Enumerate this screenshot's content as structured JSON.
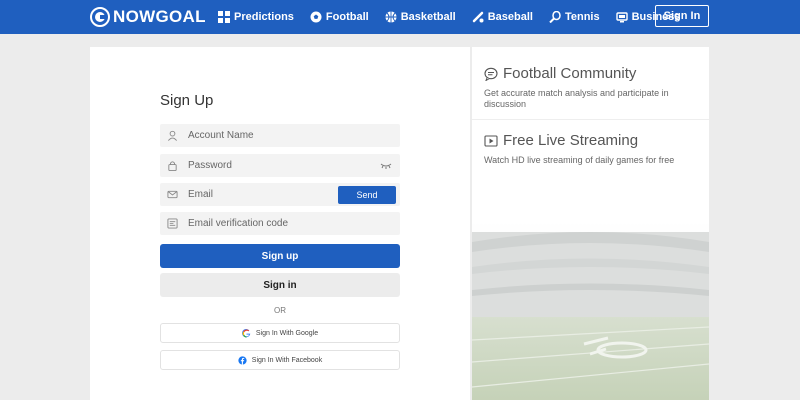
{
  "header": {
    "logo_text": "NOWGOAL",
    "nav": [
      {
        "label": "Predictions",
        "icon": "grid-icon"
      },
      {
        "label": "Football",
        "icon": "soccer-ball-icon"
      },
      {
        "label": "Basketball",
        "icon": "basketball-icon"
      },
      {
        "label": "Baseball",
        "icon": "baseball-bat-icon"
      },
      {
        "label": "Tennis",
        "icon": "tennis-racket-icon"
      },
      {
        "label": "Business",
        "icon": "business-icon"
      }
    ],
    "signin_label": "Sign In",
    "background_color": "#1f5fbf"
  },
  "form": {
    "title": "Sign Up",
    "account_placeholder": "Account Name",
    "password_placeholder": "Password",
    "email_placeholder": "Email",
    "send_label": "Send",
    "code_placeholder": "Email verification code",
    "signup_label": "Sign up",
    "signin_label": "Sign in",
    "or_text": "OR",
    "google_label": "Sign In With Google",
    "facebook_label": "Sign In With Facebook",
    "accent_color": "#1f5fbf"
  },
  "promo": {
    "community_title": "Football Community",
    "community_desc": "Get accurate match analysis and participate in discussion",
    "streaming_title": "Free Live Streaming",
    "streaming_desc": "Watch HD live streaming of daily games for free"
  }
}
